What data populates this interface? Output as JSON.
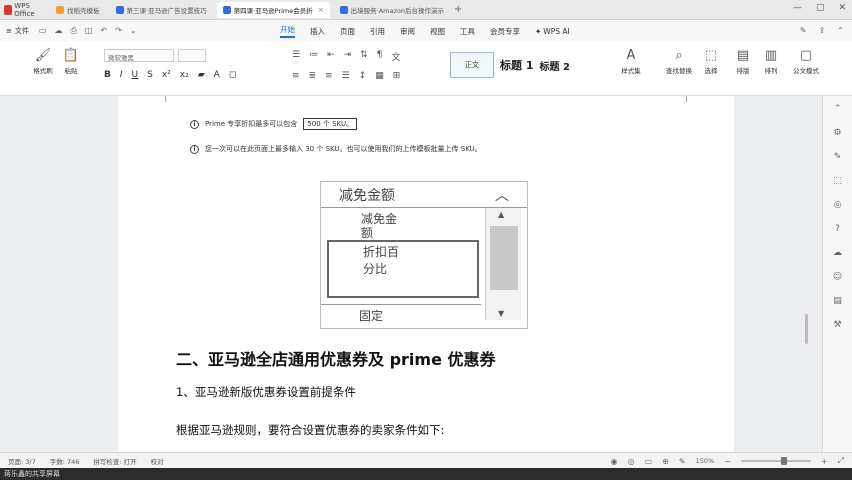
{
  "tabs": {
    "app_label": "WPS Office",
    "items": [
      {
        "label": "找稻壳模板"
      },
      {
        "label": "第三课·亚马逊广告设置技巧"
      },
      {
        "label": "第四课·亚马逊Prime会员折"
      },
      {
        "label": "出境服务·Amazon后台操作演示"
      }
    ]
  },
  "menu": {
    "file": "文件",
    "items": [
      "开始",
      "插入",
      "页面",
      "引用",
      "审阅",
      "视图",
      "工具",
      "会员专享"
    ],
    "ai": "WPS AI"
  },
  "ribbon": {
    "format_painter": "格式刷",
    "paste": "粘贴",
    "font_name": "微软雅黑",
    "style_normal": "正文",
    "style_h1": "标题 1",
    "style_h2": "标题 2",
    "styles": "样式集",
    "find_replace": "查找替换",
    "select": "选择",
    "sort": "排版",
    "layout": "排列",
    "formula": "公文模式"
  },
  "document": {
    "info1_prefix": "Prime 专享折扣最多可以包含",
    "info1_box": "500 个 SKU。",
    "info2": "您一次可以在此页面上最多输入 30 个 SKU，也可以使用我们的上传模板批量上传 SKU。",
    "dropdown": {
      "header": "减免金额",
      "item1": "减免金额",
      "item2": "折扣百分比",
      "item3": "固定"
    },
    "heading2": "二、亚马逊全店通用优惠券及 prime 优惠券",
    "heading3": "1、亚马逊新版优惠券设置前提条件",
    "paragraph": "根据亚马逊规则，要符合设置优惠券的卖家条件如下:"
  },
  "status": {
    "page": "页面: 3/7",
    "words": "字数: 746",
    "spell": "拼写检查: 打开",
    "proof": "校对",
    "zoom": "150%"
  },
  "share_bar": "蒋乐鑫的共享屏幕"
}
